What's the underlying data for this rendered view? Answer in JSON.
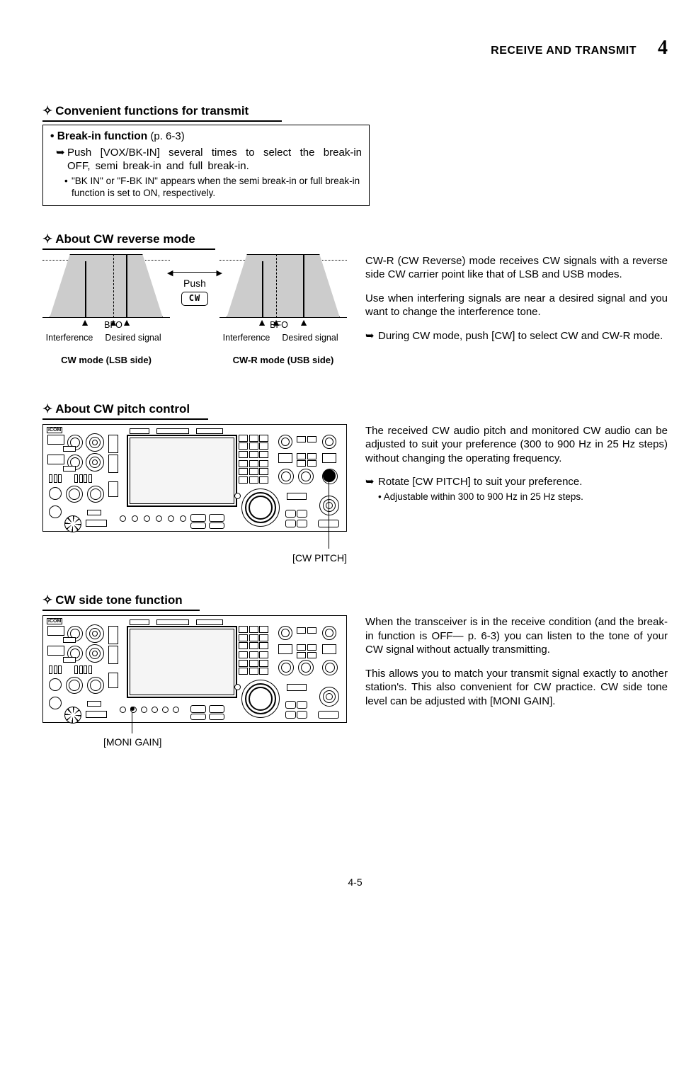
{
  "header": {
    "title": "RECEIVE AND TRANSMIT",
    "chapter": "4"
  },
  "section1": {
    "heading_prefix": "✧",
    "heading": "Convenient functions for transmit",
    "box_title": "• Break-in function",
    "box_ref": "(p. 6-3)",
    "arrow": "➥",
    "arrow_text": "Push [VOX/BK-IN] several times to select the break-in OFF, semi break-in and full break-in.",
    "sub_text": "\"BK IN\" or \"F-BK IN\" appears when the semi break-in or full break-in function is set to ON, respectively."
  },
  "section2": {
    "heading_prefix": "✧",
    "heading": "About CW reverse mode",
    "push_label": "Push",
    "cw_btn": "CW",
    "bfo": "BFO",
    "interference": "Interference",
    "desired": "Desired signal",
    "caption_left": "CW mode (LSB side)",
    "caption_right": "CW-R mode (USB side)",
    "para1": "CW-R (CW Reverse) mode receives CW signals with a reverse side CW carrier point like that of LSB and USB modes.",
    "para2": "Use when interfering signals are near a desired signal and you want to change the interference tone.",
    "arrow": "➥",
    "arrow_text": "During CW mode, push [CW] to select CW and CW-R mode."
  },
  "section3": {
    "heading_prefix": "✧",
    "heading": "About CW pitch control",
    "brand": "iCOM",
    "callout": "[CW PITCH]",
    "para1": "The received CW audio pitch and monitored CW audio can be adjusted to suit your preference (300 to 900 Hz in 25 Hz steps) without changing the operating frequency.",
    "arrow": "➥",
    "arrow_text": "Rotate [CW PITCH] to suit your preference.",
    "sub_text": "• Adjustable within 300 to 900 Hz in 25 Hz steps."
  },
  "section4": {
    "heading_prefix": "✧",
    "heading": "CW side tone function",
    "brand": "iCOM",
    "callout": "[MONI GAIN]",
    "para1": "When the transceiver is in the receive condition (and the break-in function is OFF— p. 6-3) you can listen to the tone of your CW signal without actually transmitting.",
    "para2": "This allows you to match your transmit signal exactly to another station's. This also convenient for CW practice. CW side tone level can be adjusted with [MONI GAIN]."
  },
  "footer": {
    "page": "4-5"
  }
}
